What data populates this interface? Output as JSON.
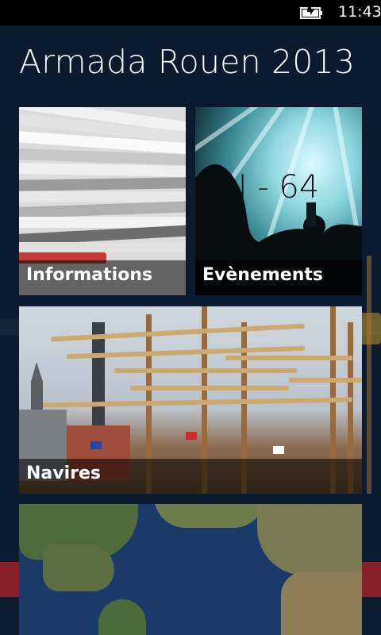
{
  "status_bar": {
    "time": "11:43",
    "battery_icon": "battery-charging-icon"
  },
  "app": {
    "title": "Armada Rouen 2013"
  },
  "tiles": [
    {
      "label": "Informations",
      "image": "newspapers-image"
    },
    {
      "label": "Evènements",
      "image": "concert-image",
      "countdown": "J - 64"
    },
    {
      "label": "Navires",
      "image": "tall-ships-image"
    },
    {
      "label": "",
      "image": "world-map-image"
    }
  ],
  "colors": {
    "background": "#0b1a2e",
    "tile_label_overlay": "rgba(0,0,0,0.55)",
    "status_bar": "#000000"
  }
}
